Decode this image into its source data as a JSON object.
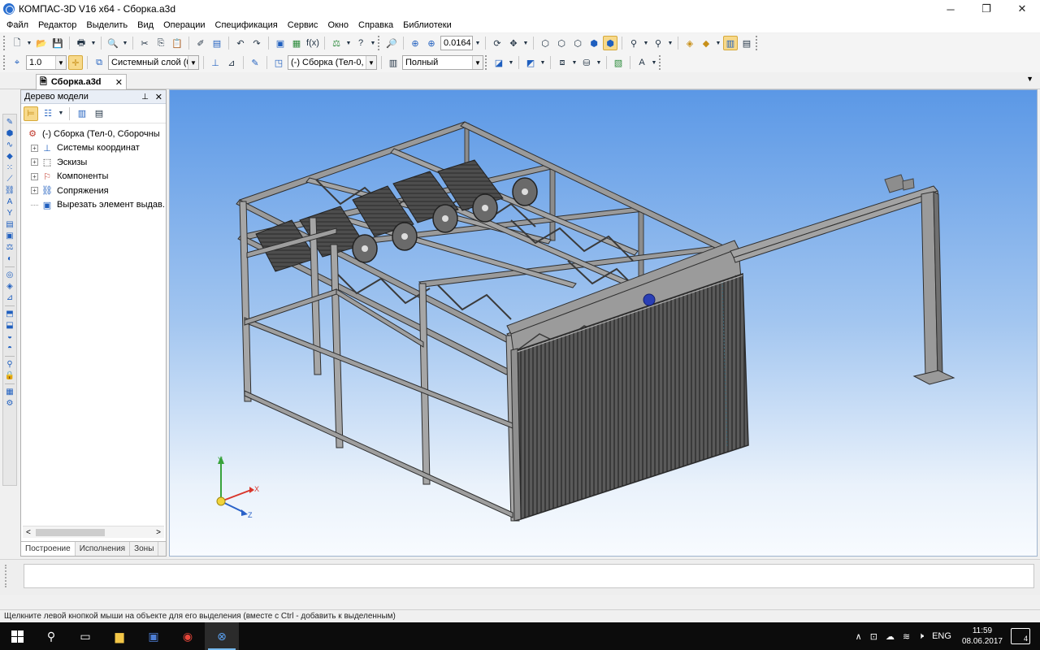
{
  "window": {
    "title": "КОМПАС-3D V16  x64 - Сборка.a3d",
    "controls": {
      "minimize": "─",
      "restore": "❐",
      "close": "✕"
    }
  },
  "menu": {
    "items": [
      "Файл",
      "Редактор",
      "Выделить",
      "Вид",
      "Операции",
      "Спецификация",
      "Сервис",
      "Окно",
      "Справка",
      "Библиотеки"
    ]
  },
  "toolbar1": {
    "zoom_value": "0.0164"
  },
  "toolbar2": {
    "step_value": "1.0",
    "layer_value": "Системный слой (0)",
    "part_value": "(-) Сборка (Тел-0, С",
    "display_mode": "Полный"
  },
  "document_tab": {
    "label": "Сборка.a3d",
    "close": "✕"
  },
  "model_tree": {
    "title": "Дерево модели",
    "pin": "📌",
    "close": "✕",
    "root": "(-) Сборка (Тел-0, Сборочны",
    "items": [
      {
        "label": "Системы координат",
        "expand": "+"
      },
      {
        "label": "Эскизы",
        "expand": "+"
      },
      {
        "label": "Компоненты",
        "expand": "+"
      },
      {
        "label": "Сопряжения",
        "expand": "+"
      },
      {
        "label": "Вырезать элемент выдав.",
        "expand": ""
      }
    ],
    "tabs": [
      "Построение",
      "Исполнения",
      "Зоны"
    ],
    "scroll_left": "<",
    "scroll_right": ">"
  },
  "viewport": {
    "axes": {
      "x": "X",
      "y": "Y",
      "z": "Z"
    }
  },
  "statusbar": {
    "text": "Щелкните левой кнопкой мыши на объекте для его выделения (вместе с Ctrl - добавить к выделенным)"
  },
  "taskbar": {
    "lang": "ENG",
    "time": "11:59",
    "date": "08.06.2017",
    "notifications": "4"
  }
}
